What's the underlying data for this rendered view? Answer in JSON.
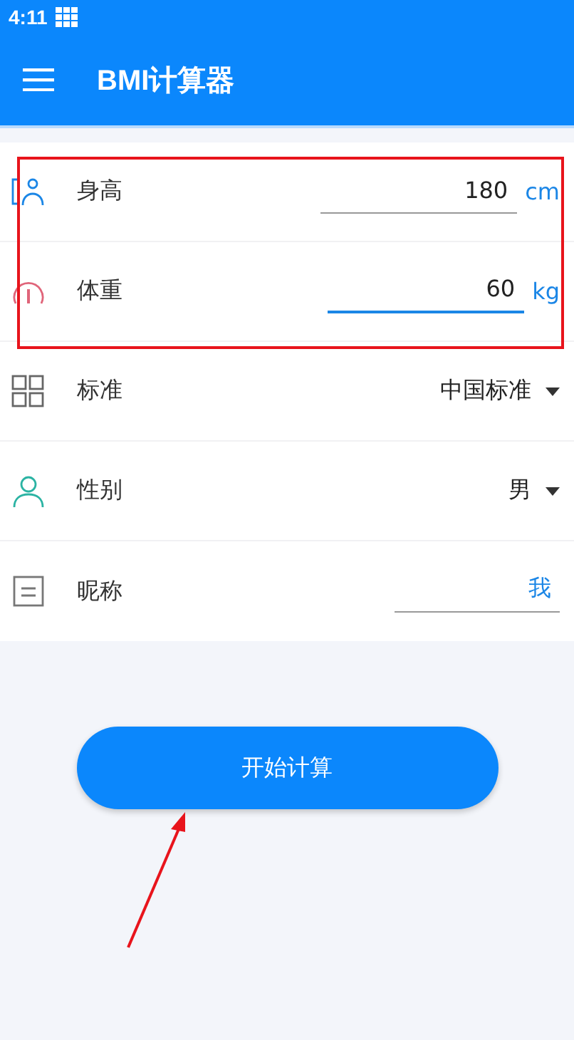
{
  "status_bar": {
    "time": "4:11"
  },
  "app_bar": {
    "title": "BMI计算器"
  },
  "rows": [
    {
      "kind": "input",
      "label": "身高",
      "value": "180",
      "unit": "cm",
      "focused": false
    },
    {
      "kind": "input",
      "label": "体重",
      "value": "60",
      "unit": "kg",
      "focused": true
    },
    {
      "kind": "select",
      "label": "标准",
      "value": "中国标准"
    },
    {
      "kind": "select",
      "label": "性别",
      "value": "男"
    },
    {
      "kind": "text",
      "label": "昵称",
      "value": "我"
    }
  ],
  "action_button": {
    "label": "开始计算"
  }
}
